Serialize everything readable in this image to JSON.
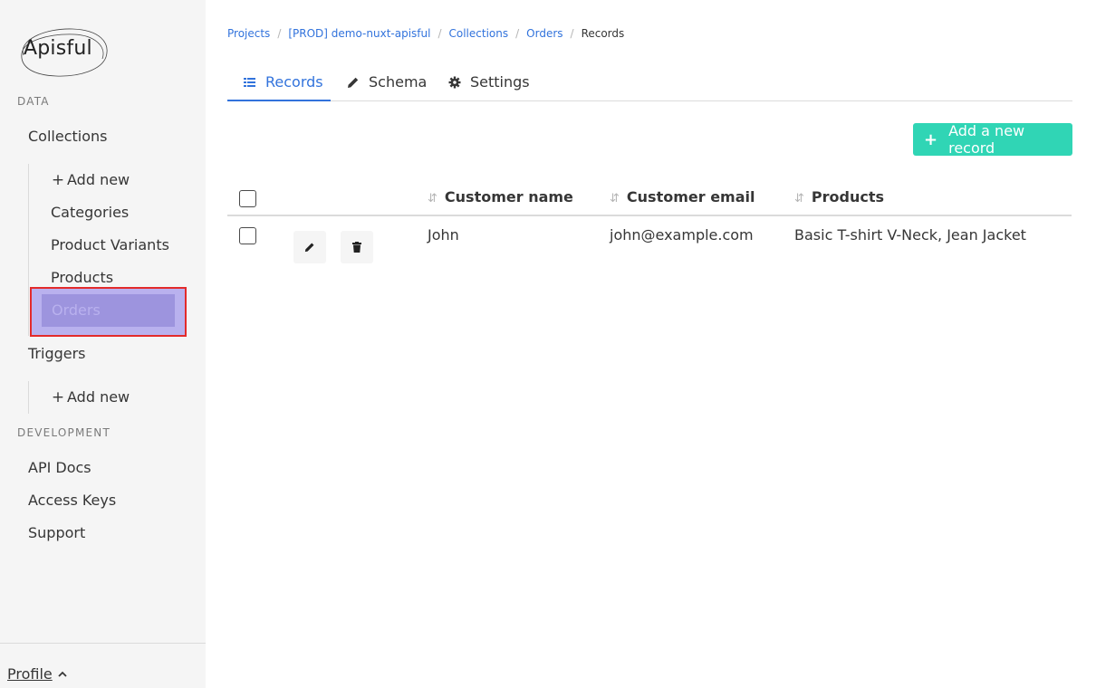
{
  "app": {
    "logo_text": "Apisful"
  },
  "sidebar": {
    "sections": [
      {
        "label": "Data"
      },
      {
        "label": "Development"
      }
    ],
    "collections_label": "Collections",
    "collections_add_new": "Add new",
    "collections": [
      "Categories",
      "Product Variants",
      "Products",
      "Orders"
    ],
    "triggers_label": "Triggers",
    "triggers_add_new": "Add new",
    "dev_items": [
      "API Docs",
      "Access Keys",
      "Support"
    ],
    "profile_label": "Profile"
  },
  "breadcrumb": {
    "items": [
      "Projects",
      "[PROD] demo-nuxt-apisful",
      "Collections",
      "Orders"
    ],
    "current": "Records"
  },
  "tabs": [
    {
      "label": "Records",
      "icon": "list-icon",
      "active": true
    },
    {
      "label": "Schema",
      "icon": "pencil-icon",
      "active": false
    },
    {
      "label": "Settings",
      "icon": "gear-icon",
      "active": false
    }
  ],
  "toolbar": {
    "add_record_label": "Add a new record"
  },
  "table": {
    "columns": [
      "Customer name",
      "Customer email",
      "Products"
    ],
    "rows": [
      {
        "customer_name": "John",
        "customer_email": "john@example.com",
        "products": "Basic T-shirt V-Neck, Jean Jacket"
      }
    ]
  },
  "colors": {
    "accent": "#3273dc",
    "primary_button": "#30d5b5",
    "sidebar_bg": "#f5f5f5",
    "selected_item_bg": "#9d94de",
    "selection_outline": "#e32b2b"
  }
}
